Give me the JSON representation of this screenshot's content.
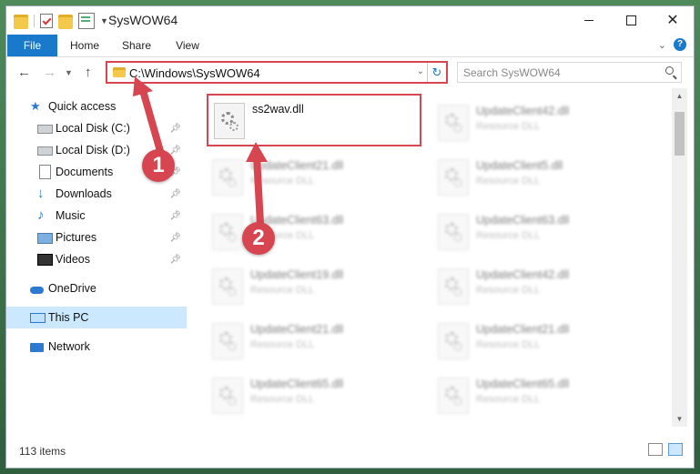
{
  "window": {
    "title": "SysWOW64"
  },
  "ribbon": {
    "tabs": [
      "File",
      "Home",
      "Share",
      "View"
    ]
  },
  "address": {
    "path": "C:\\Windows\\SysWOW64",
    "search_placeholder": "Search SysWOW64"
  },
  "navpane": {
    "items": [
      {
        "label": "Quick access",
        "icon": "quick-access-star-icon",
        "pinned": false
      },
      {
        "label": "Local Disk (C:)",
        "icon": "local-disk-icon",
        "pinned": true
      },
      {
        "label": "Local Disk (D:)",
        "icon": "local-disk-icon",
        "pinned": true
      },
      {
        "label": "Documents",
        "icon": "documents-icon",
        "pinned": true
      },
      {
        "label": "Downloads",
        "icon": "downloads-icon",
        "pinned": true
      },
      {
        "label": "Music",
        "icon": "music-icon",
        "pinned": true
      },
      {
        "label": "Pictures",
        "icon": "pictures-icon",
        "pinned": true
      },
      {
        "label": "Videos",
        "icon": "videos-icon",
        "pinned": true
      },
      {
        "label": "OneDrive",
        "icon": "onedrive-icon",
        "pinned": false
      },
      {
        "label": "This PC",
        "icon": "this-pc-icon",
        "pinned": false,
        "selected": true
      },
      {
        "label": "Network",
        "icon": "network-icon",
        "pinned": false
      }
    ]
  },
  "files": {
    "highlighted": {
      "name": "ss2wav.dll"
    },
    "blurred": [
      {
        "name": "UpdateClient42.dll",
        "type": "Resource DLL"
      },
      {
        "name": "UpdateClient21.dll",
        "type": "Resource DLL"
      },
      {
        "name": "UpdateClient5.dll",
        "type": "Resource DLL"
      },
      {
        "name": "UpdateClient63.dll",
        "type": "Resource DLL"
      },
      {
        "name": "UpdateClient63.dll",
        "type": "Resource DLL"
      },
      {
        "name": "UpdateClient19.dll",
        "type": "Resource DLL"
      },
      {
        "name": "UpdateClient42.dll",
        "type": "Resource DLL"
      },
      {
        "name": "UpdateClient21.dll",
        "type": "Resource DLL"
      },
      {
        "name": "UpdateClient21.dll",
        "type": "Resource DLL"
      },
      {
        "name": "UpdateClient65.dll",
        "type": "Resource DLL"
      },
      {
        "name": "UpdateClient65.dll",
        "type": "Resource DLL"
      }
    ]
  },
  "status": {
    "item_count": "113 items"
  },
  "annotations": {
    "callout_1": "1",
    "callout_2": "2",
    "color": "#d64550"
  }
}
